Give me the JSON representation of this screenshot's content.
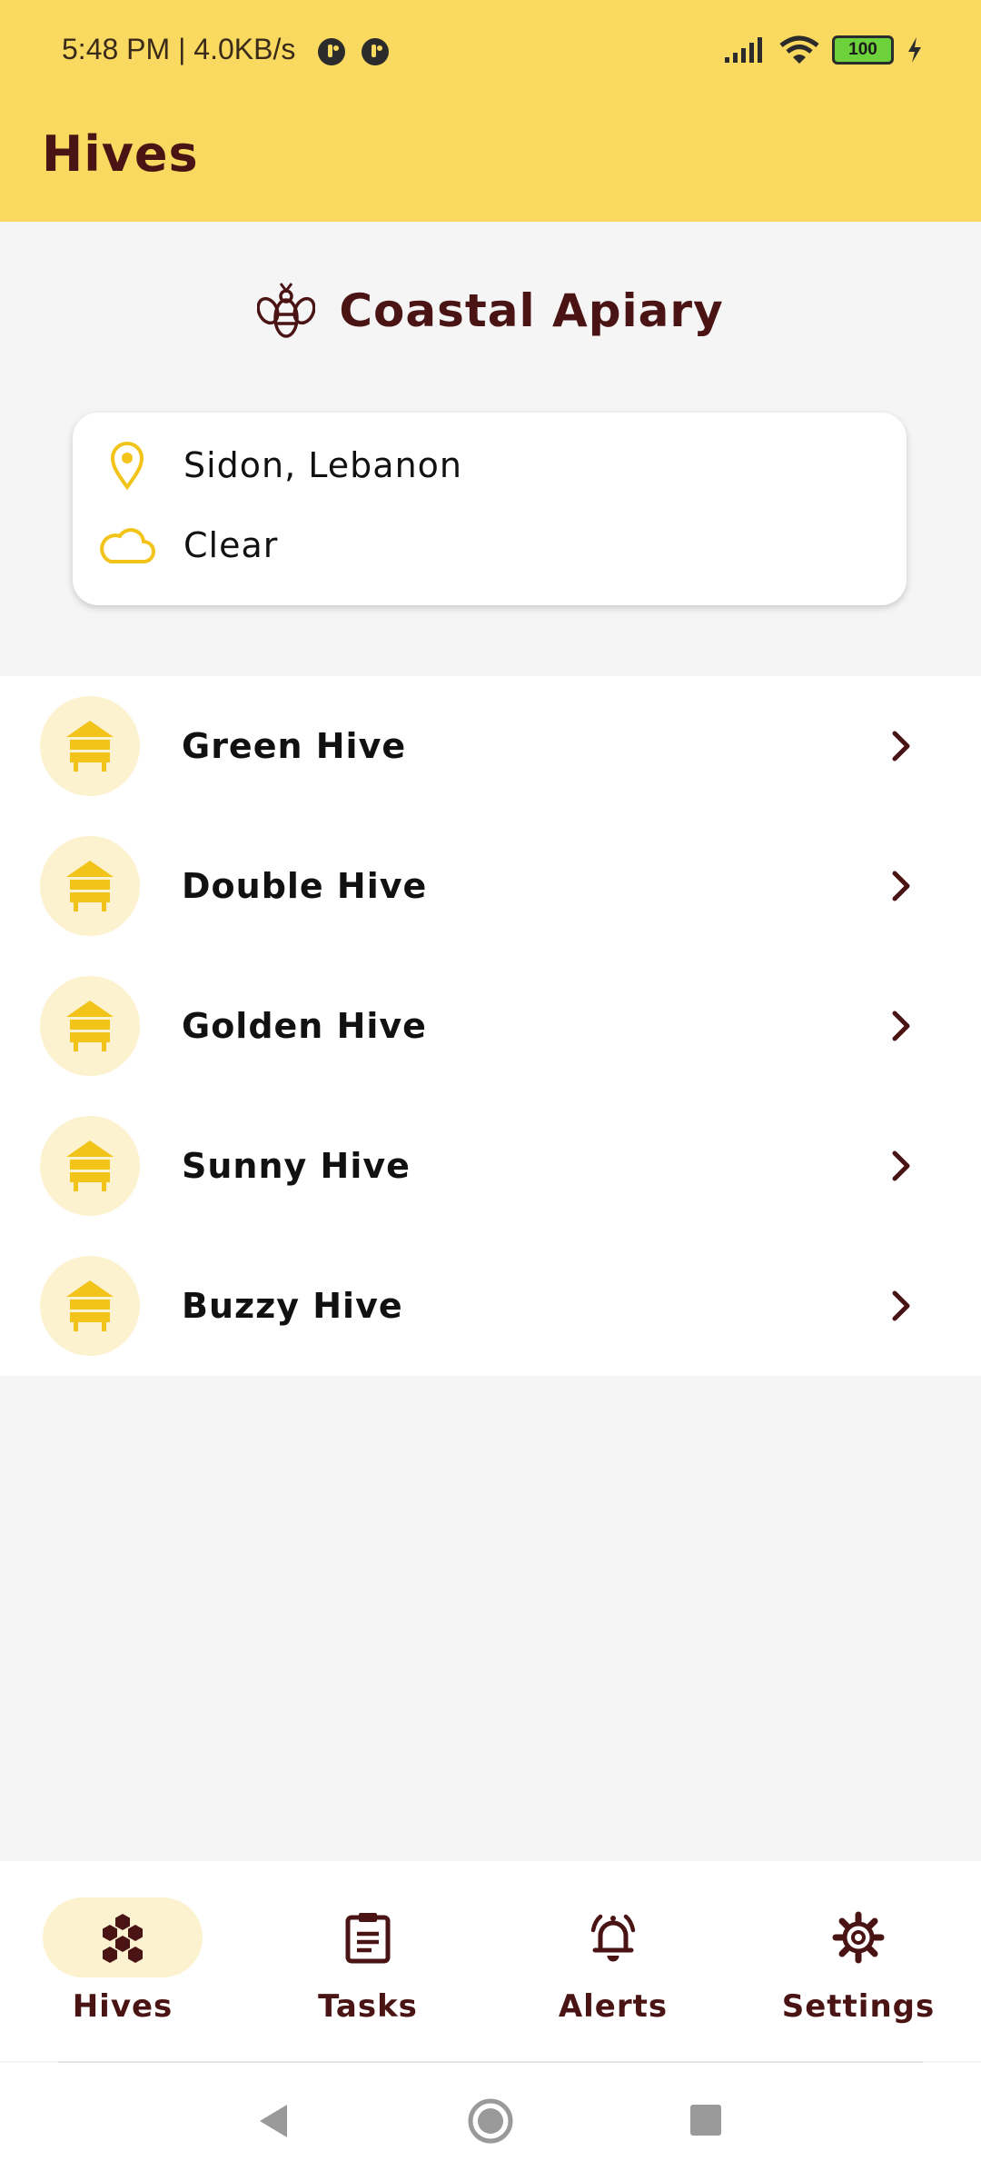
{
  "status_bar": {
    "time": "5:48 PM | 4.0KB/s",
    "battery": "100"
  },
  "app_bar": {
    "title": "Hives"
  },
  "apiary": {
    "name": "Coastal Apiary",
    "location": "Sidon, Lebanon",
    "weather": "Clear"
  },
  "hives": [
    {
      "name": "Green Hive"
    },
    {
      "name": "Double Hive"
    },
    {
      "name": "Golden Hive"
    },
    {
      "name": "Sunny Hive"
    },
    {
      "name": "Buzzy Hive"
    }
  ],
  "bottom_nav": {
    "items": [
      {
        "label": "Hives",
        "icon": "honeycomb-icon",
        "active": true
      },
      {
        "label": "Tasks",
        "icon": "clipboard-icon",
        "active": false
      },
      {
        "label": "Alerts",
        "icon": "bell-icon",
        "active": false
      },
      {
        "label": "Settings",
        "icon": "gear-icon",
        "active": false
      }
    ]
  },
  "colors": {
    "app_bar": "#f9d95f",
    "primary_text": "#4a1414",
    "accent_yellow": "#f2c41a",
    "avatar_bg": "#fdf2cf"
  }
}
